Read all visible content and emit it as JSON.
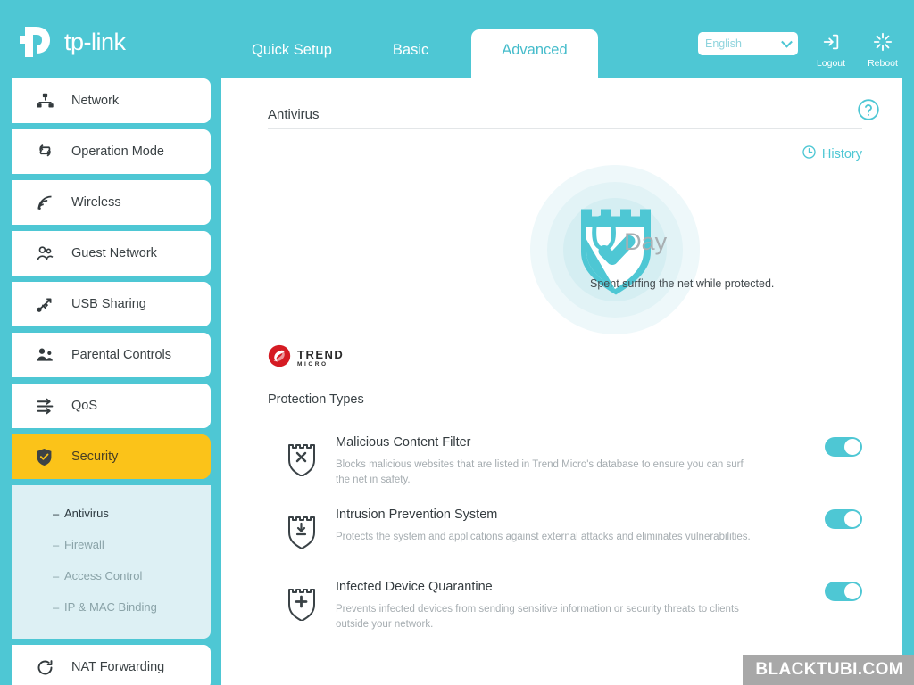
{
  "brand": {
    "name": "tp-link"
  },
  "nav": {
    "tabs": [
      {
        "label": "Quick Setup",
        "active": false
      },
      {
        "label": "Basic",
        "active": false
      },
      {
        "label": "Advanced",
        "active": true
      }
    ]
  },
  "topbar": {
    "language": {
      "value": "English",
      "icon": "chevron-down-icon"
    },
    "logout": {
      "label": "Logout",
      "icon": "logout-icon"
    },
    "reboot": {
      "label": "Reboot",
      "icon": "reboot-icon"
    }
  },
  "sidebar": {
    "items": [
      {
        "label": "Network",
        "icon": "network-icon",
        "active": false
      },
      {
        "label": "Operation Mode",
        "icon": "operation-mode-icon",
        "active": false
      },
      {
        "label": "Wireless",
        "icon": "wireless-icon",
        "active": false
      },
      {
        "label": "Guest Network",
        "icon": "guest-network-icon",
        "active": false
      },
      {
        "label": "USB Sharing",
        "icon": "usb-sharing-icon",
        "active": false
      },
      {
        "label": "Parental Controls",
        "icon": "parental-controls-icon",
        "active": false
      },
      {
        "label": "QoS",
        "icon": "qos-icon",
        "active": false
      },
      {
        "label": "Security",
        "icon": "security-shield-icon",
        "active": true
      },
      {
        "label": "NAT Forwarding",
        "icon": "nat-forwarding-icon",
        "active": false
      }
    ],
    "submenu": {
      "parent": "Security",
      "items": [
        {
          "label": "Antivirus",
          "active": true
        },
        {
          "label": "Firewall",
          "active": false
        },
        {
          "label": "Access Control",
          "active": false
        },
        {
          "label": "IP & MAC Binding",
          "active": false
        }
      ],
      "bullet": "–"
    }
  },
  "main": {
    "title": "Antivirus",
    "help": {
      "icon": "help-circle-icon"
    },
    "history": {
      "label": "History",
      "icon": "clock-icon"
    },
    "status": {
      "shield_icon": "protected-shield-check-icon",
      "count": "0",
      "unit": "Day",
      "caption": "Spent surfing the net while protected."
    },
    "vendor": {
      "line1": "TREND",
      "line2": "MICRO",
      "icon": "trend-micro-logo-icon"
    },
    "protection": {
      "title": "Protection Types",
      "items": [
        {
          "name": "Malicious Content Filter",
          "description": "Blocks malicious websites that are listed in Trend Micro's database to ensure you can surf the net in safety.",
          "icon": "shield-x-icon",
          "enabled": true
        },
        {
          "name": "Intrusion Prevention System",
          "description": "Protects the system and applications against external attacks and eliminates vulnerabilities.",
          "icon": "shield-download-icon",
          "enabled": true
        },
        {
          "name": "Infected Device Quarantine",
          "description": "Prevents infected devices from sending sensitive information or security threats to clients outside your network.",
          "icon": "shield-plus-icon",
          "enabled": true
        }
      ]
    }
  },
  "watermark": {
    "text": "BLACKTUBI.COM"
  },
  "colors": {
    "brand_teal": "#4ec7d4",
    "active_amber": "#fbc319",
    "submenu_bg": "#ddf0f4",
    "toggle_on": "#4ec7d4"
  }
}
